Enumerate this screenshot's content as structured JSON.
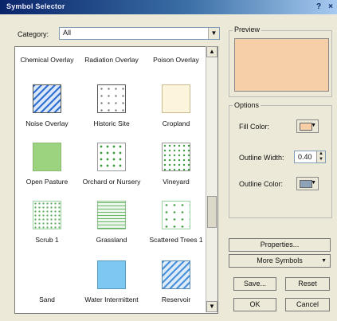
{
  "window": {
    "title": "Symbol Selector",
    "help": "?",
    "close": "×"
  },
  "category": {
    "label": "Category:",
    "value": "All"
  },
  "symbols_top_row": [
    "Chemical Overlay",
    "Radiation Overlay",
    "Poison Overlay"
  ],
  "symbols": [
    {
      "label": "Noise Overlay",
      "icon": "diagonal-hatch-blue"
    },
    {
      "label": "Historic Site",
      "icon": "dotted-triangle"
    },
    {
      "label": "Cropland",
      "icon": "light-yellow-fill"
    },
    {
      "label": "Open Pasture",
      "icon": "green-fill"
    },
    {
      "label": "Orchard or Nursery",
      "icon": "green-dots"
    },
    {
      "label": "Vineyard",
      "icon": "green-dot-grid"
    },
    {
      "label": "Scrub 1",
      "icon": "green-speckle"
    },
    {
      "label": "Grassland",
      "icon": "green-grass"
    },
    {
      "label": "Scattered Trees 1",
      "icon": "green-scatter"
    },
    {
      "label": "Sand",
      "icon": "none"
    },
    {
      "label": "Water Intermittent",
      "icon": "blue-fill"
    },
    {
      "label": "Reservoir",
      "icon": "blue-hatch"
    }
  ],
  "preview": {
    "label": "Preview",
    "color": "#f6cfa8"
  },
  "options": {
    "label": "Options",
    "fill_color_label": "Fill Color:",
    "fill_color": "#f6cfa8",
    "outline_width_label": "Outline Width:",
    "outline_width": "0.40",
    "outline_color_label": "Outline Color:",
    "outline_color": "#8fa3b8"
  },
  "buttons": {
    "properties": "Properties...",
    "more_symbols": "More Symbols",
    "save": "Save...",
    "reset": "Reset",
    "ok": "OK",
    "cancel": "Cancel"
  }
}
